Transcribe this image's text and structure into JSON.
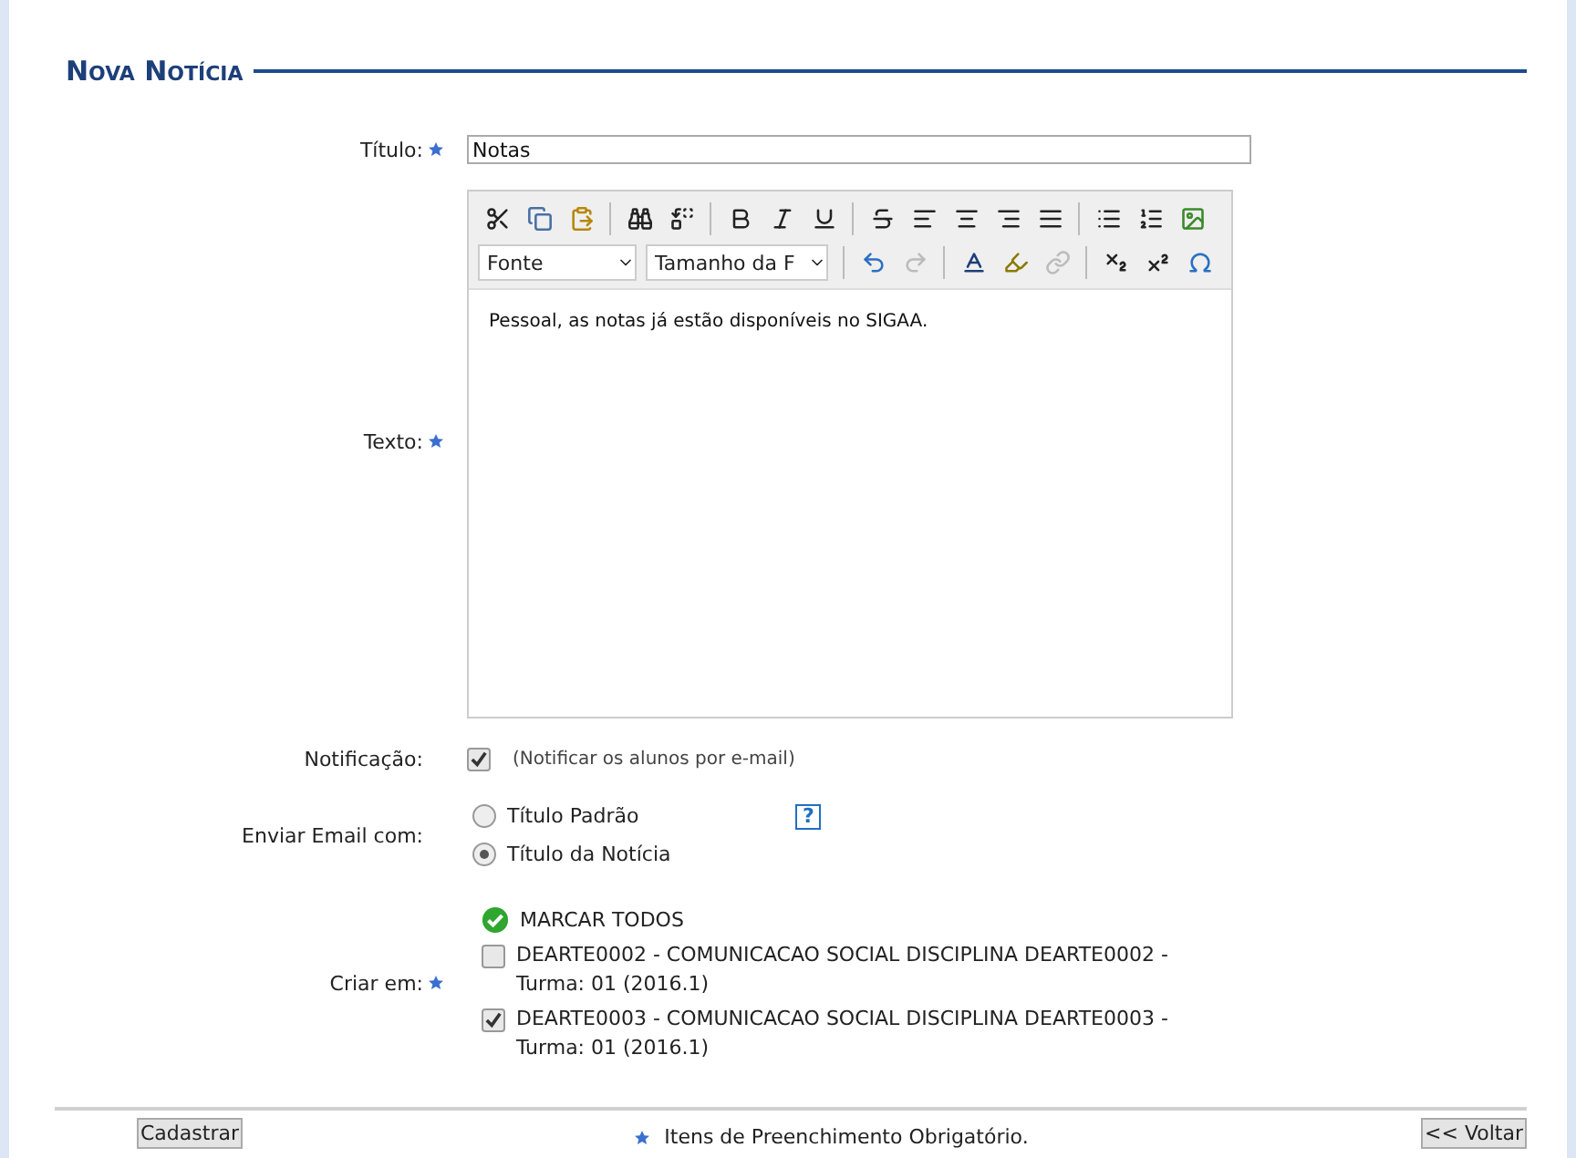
{
  "heading": "Nova Notícia",
  "title_field": {
    "label": "Título:",
    "required": true,
    "value": "Notas"
  },
  "text_field": {
    "label": "Texto:",
    "required": true,
    "toolbar": [
      [
        {
          "kind": "cut",
          "disabled": false
        },
        {
          "kind": "copy",
          "disabled": false
        },
        {
          "kind": "paste",
          "disabled": false
        },
        {
          "kind": "separator"
        },
        {
          "kind": "find",
          "disabled": false
        },
        {
          "kind": "replace",
          "disabled": false
        },
        {
          "kind": "separator"
        },
        {
          "kind": "bold",
          "disabled": false
        },
        {
          "kind": "italic",
          "disabled": false
        },
        {
          "kind": "underline",
          "disabled": false
        },
        {
          "kind": "separator"
        },
        {
          "kind": "strike",
          "disabled": false
        },
        {
          "kind": "alignleft",
          "disabled": false
        },
        {
          "kind": "aligncenter",
          "disabled": false
        },
        {
          "kind": "alignright",
          "disabled": false
        },
        {
          "kind": "justify",
          "disabled": false
        },
        {
          "kind": "separator"
        },
        {
          "kind": "bullets",
          "disabled": false
        },
        {
          "kind": "numbers",
          "disabled": false
        },
        {
          "kind": "image",
          "disabled": false
        }
      ],
      [
        {
          "kind": "select",
          "value": "Fonte"
        },
        {
          "kind": "select",
          "value": "Tamanho da F"
        },
        {
          "kind": "separator"
        },
        {
          "kind": "undo",
          "disabled": false
        },
        {
          "kind": "redo",
          "disabled": true
        },
        {
          "kind": "separator"
        },
        {
          "kind": "textcolor",
          "disabled": false
        },
        {
          "kind": "highlight",
          "disabled": false
        },
        {
          "kind": "link",
          "disabled": true
        },
        {
          "kind": "separator"
        },
        {
          "kind": "subscript",
          "disabled": false
        },
        {
          "kind": "superscript",
          "disabled": false
        },
        {
          "kind": "symbol",
          "disabled": false
        }
      ]
    ],
    "content": "Pessoal, as notas já estão disponíveis no SIGAA."
  },
  "notification": {
    "label": "Notificação:",
    "checked": true,
    "hint": "(Notificar os alunos por e-mail)"
  },
  "email_title": {
    "label": "Enviar Email com:",
    "options": [
      {
        "label": "Título Padrão",
        "selected": false
      },
      {
        "label": "Título da Notícia",
        "selected": true
      }
    ],
    "help": "?"
  },
  "create_in": {
    "label": "Criar em:",
    "required": true,
    "select_all": "MARCAR TODOS",
    "classes": [
      {
        "label": "DEARTE0002 - COMUNICACAO SOCIAL DISCIPLINA DEARTE0002 - Turma: 01 (2016.1)",
        "checked": false
      },
      {
        "label": "DEARTE0003 - COMUNICACAO SOCIAL DISCIPLINA DEARTE0003 - Turma: 01 (2016.1)",
        "checked": true
      }
    ]
  },
  "footer": {
    "submit": "Cadastrar",
    "note": "Itens de Preenchimento Obrigatório.",
    "back": "<< Voltar"
  }
}
